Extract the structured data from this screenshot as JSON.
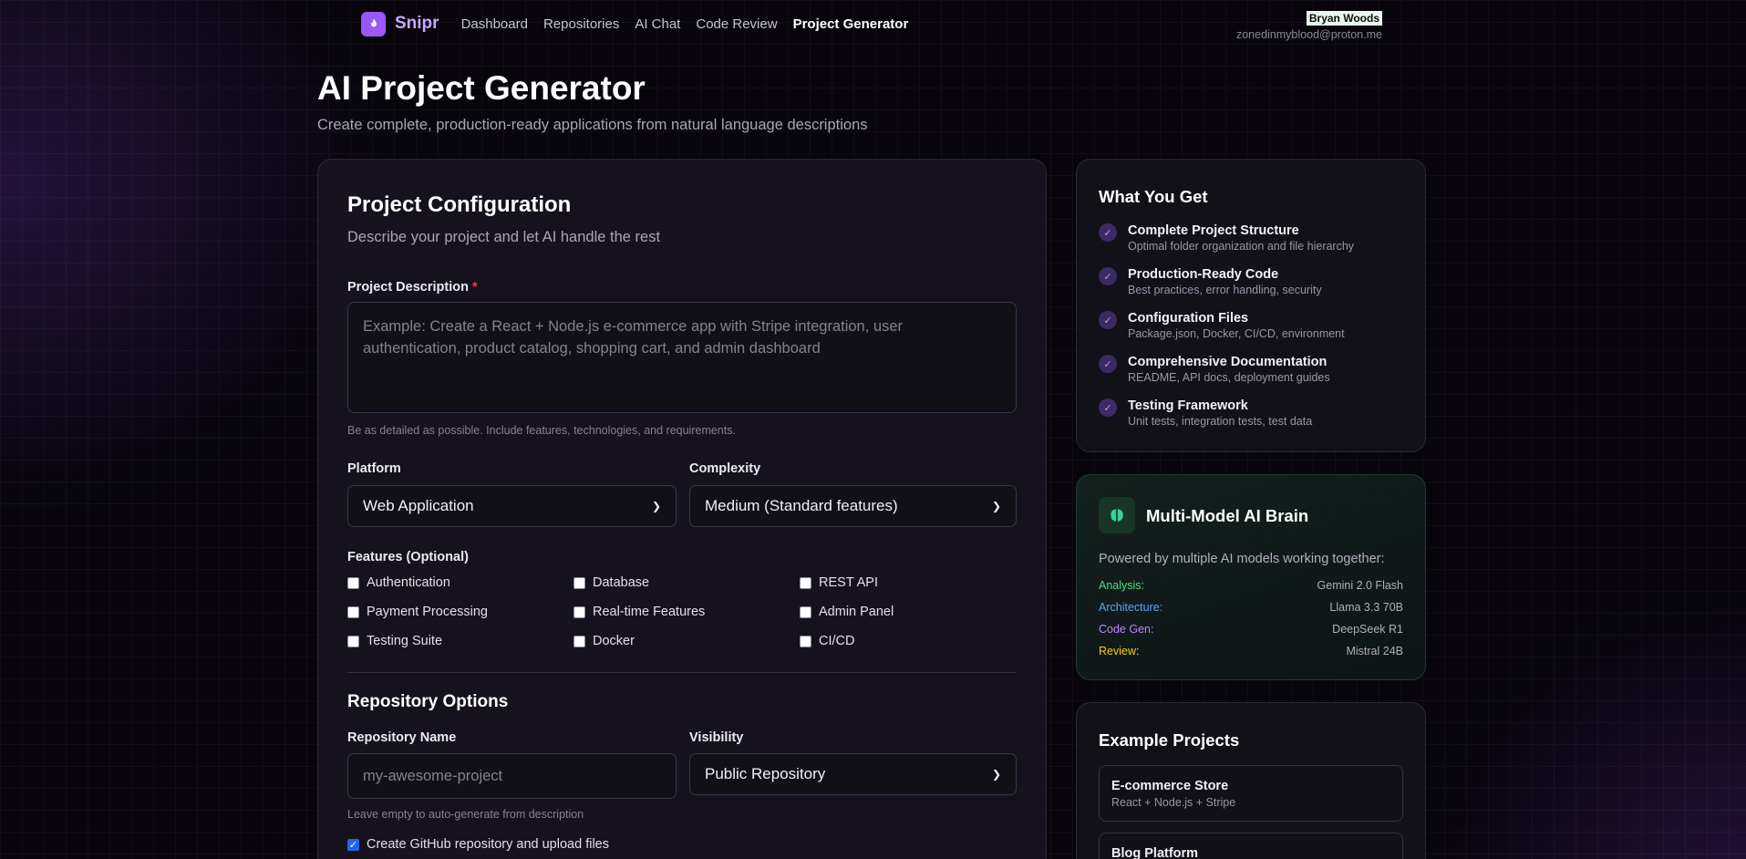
{
  "nav": {
    "brand": "Snipr",
    "links": [
      "Dashboard",
      "Repositories",
      "AI Chat",
      "Code Review",
      "Project Generator"
    ],
    "active": "Project Generator"
  },
  "user": {
    "name": "Bryan Woods",
    "email": "zonedinmyblood@proton.me"
  },
  "header": {
    "title": "AI Project Generator",
    "subtitle": "Create complete, production-ready applications from natural language descriptions"
  },
  "config": {
    "title": "Project Configuration",
    "subtitle": "Describe your project and let AI handle the rest",
    "description_label": "Project Description",
    "required_mark": "*",
    "description_placeholder": "Example: Create a React + Node.js e-commerce app with Stripe integration, user authentication, product catalog, shopping cart, and admin dashboard",
    "description_hint": "Be as detailed as possible. Include features, technologies, and requirements.",
    "platform_label": "Platform",
    "platform_value": "Web Application",
    "complexity_label": "Complexity",
    "complexity_value": "Medium (Standard features)",
    "features_label": "Features (Optional)",
    "features": [
      {
        "label": "Authentication",
        "checked": false
      },
      {
        "label": "Database",
        "checked": false
      },
      {
        "label": "REST API",
        "checked": false
      },
      {
        "label": "Payment Processing",
        "checked": false
      },
      {
        "label": "Real-time Features",
        "checked": false
      },
      {
        "label": "Admin Panel",
        "checked": false
      },
      {
        "label": "Testing Suite",
        "checked": false
      },
      {
        "label": "Docker",
        "checked": false
      },
      {
        "label": "CI/CD",
        "checked": false
      }
    ]
  },
  "repo": {
    "title": "Repository Options",
    "name_label": "Repository Name",
    "name_placeholder": "my-awesome-project",
    "name_hint": "Leave empty to auto-generate from description",
    "visibility_label": "Visibility",
    "visibility_value": "Public Repository",
    "create_label": "Create GitHub repository and upload files",
    "create_checked": true
  },
  "what_you_get": {
    "title": "What You Get",
    "items": [
      {
        "title": "Complete Project Structure",
        "sub": "Optimal folder organization and file hierarchy"
      },
      {
        "title": "Production-Ready Code",
        "sub": "Best practices, error handling, security"
      },
      {
        "title": "Configuration Files",
        "sub": "Package.json, Docker, CI/CD, environment"
      },
      {
        "title": "Comprehensive Documentation",
        "sub": "README, API docs, deployment guides"
      },
      {
        "title": "Testing Framework",
        "sub": "Unit tests, integration tests, test data"
      }
    ]
  },
  "brain": {
    "title": "Multi-Model AI Brain",
    "subtitle": "Powered by multiple AI models working together:",
    "models": [
      {
        "role": "Analysis:",
        "model": "Gemini 2.0 Flash",
        "color": "#4ade80"
      },
      {
        "role": "Architecture:",
        "model": "Llama 3.3 70B",
        "color": "#60a5fa"
      },
      {
        "role": "Code Gen:",
        "model": "DeepSeek R1",
        "color": "#c084fc"
      },
      {
        "role": "Review:",
        "model": "Mistral 24B",
        "color": "#facc15"
      }
    ]
  },
  "examples": {
    "title": "Example Projects",
    "items": [
      {
        "title": "E-commerce Store",
        "sub": "React + Node.js + Stripe"
      },
      {
        "title": "Blog Platform",
        "sub": ""
      }
    ]
  }
}
